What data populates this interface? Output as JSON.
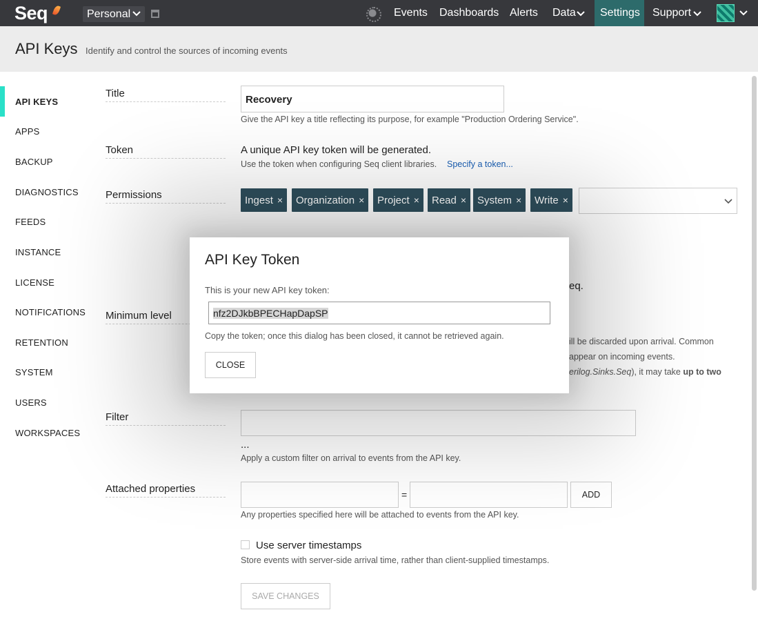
{
  "nav": {
    "logo": "Seq",
    "workspace": "Personal",
    "links": [
      "Events",
      "Dashboards",
      "Alerts",
      "Data",
      "Settings",
      "Support"
    ],
    "active": "Settings"
  },
  "header": {
    "title": "API Keys",
    "subtitle": "Identify and control the sources of incoming events"
  },
  "sidebar": {
    "items": [
      "API KEYS",
      "APPS",
      "BACKUP",
      "DIAGNOSTICS",
      "FEEDS",
      "INSTANCE",
      "LICENSE",
      "NOTIFICATIONS",
      "RETENTION",
      "SYSTEM",
      "USERS",
      "WORKSPACES"
    ],
    "active": "API KEYS"
  },
  "form": {
    "title_label": "Title",
    "title_value": "Recovery",
    "title_help": "Give the API key a title reflecting its purpose, for example \"Production Ordering Service\".",
    "token_label": "Token",
    "token_text": "A unique API key token will be generated.",
    "token_help": "Use the token when configuring Seq client libraries.",
    "token_link": "Specify a token...",
    "permissions_label": "Permissions",
    "permissions": [
      "Ingest",
      "Organization",
      "Project",
      "Read",
      "System",
      "Write"
    ],
    "remove_glyph": "×",
    "partial_seq": "eq.",
    "minlevel_label": "Minimum level",
    "minlevel_help_1": "ill be discarded upon arrival. Common",
    "minlevel_help_2": "appear on incoming events.",
    "minlevel_help_3_italic": "erilog.Sinks.Seq",
    "minlevel_help_3_rest": "), it may take ",
    "minlevel_help_3_bold": "up to two",
    "filter_label": "Filter",
    "filter_ellipsis": "...",
    "filter_help": "Apply a custom filter on arrival to events from the API key.",
    "attached_label": "Attached properties",
    "equals": "=",
    "add_button": "ADD",
    "attached_help": "Any properties specified here will be attached to events from the API key.",
    "server_ts_label": "Use server timestamps",
    "server_ts_help": "Store events with server-side arrival time, rather than client-supplied timestamps.",
    "save_button": "SAVE CHANGES"
  },
  "modal": {
    "title": "API Key Token",
    "message": "This is your new API key token:",
    "token": "nfz2DJkbBPECHapDapSP",
    "warning": "Copy the token; once this dialog has been closed, it cannot be retrieved again.",
    "close_button": "CLOSE"
  },
  "colors": {
    "topnav": "#37383c",
    "active_nav": "#2d6b6b",
    "sidebar_accent": "#2ae0c8",
    "tag_bg": "#2f4f5d",
    "link": "#1a5fb4"
  }
}
